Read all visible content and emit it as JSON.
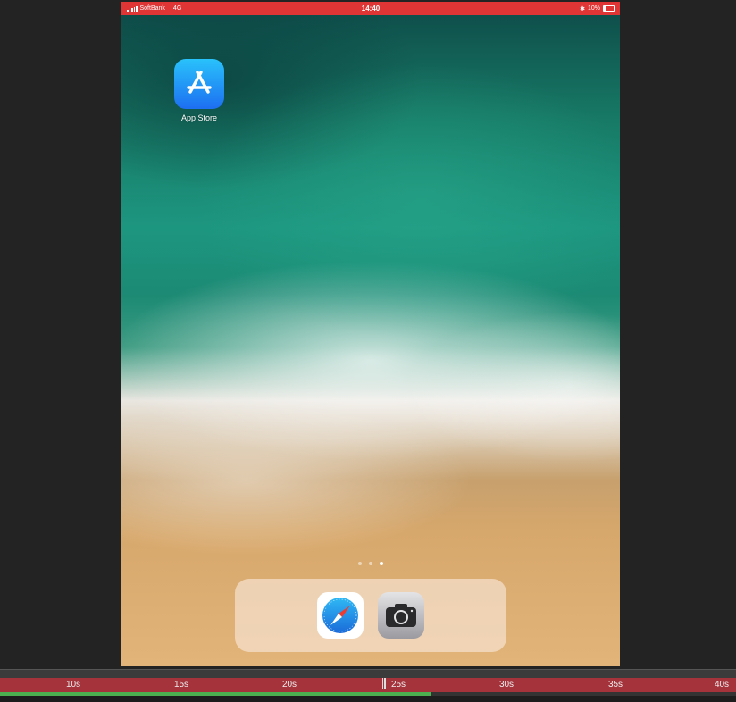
{
  "status_bar": {
    "carrier": "SoftBank",
    "network": "4G",
    "time": "14:40",
    "battery": "10%",
    "icons": [
      "signal-bars-icon",
      "bluetooth-icon",
      "battery-icon"
    ]
  },
  "home_screen": {
    "apps": [
      {
        "name": "App Store",
        "icon": "app-store-icon"
      }
    ],
    "page_count": 3,
    "active_page": 3,
    "dock": [
      {
        "name": "Safari",
        "icon": "safari-compass-icon"
      },
      {
        "name": "Camera",
        "icon": "camera-icon"
      }
    ]
  },
  "timeline": {
    "ticks": [
      "10s",
      "15s",
      "20s",
      "25s",
      "30s",
      "35s",
      "40s"
    ],
    "progress_fraction": 0.585
  },
  "colors": {
    "status_bar_bg": "#e03535",
    "timeline_ruler": "#a4333b",
    "progress_fill": "#4caf50",
    "app_store_gradient_top": "#29c2fb",
    "app_store_gradient_bottom": "#1d6ff1"
  }
}
